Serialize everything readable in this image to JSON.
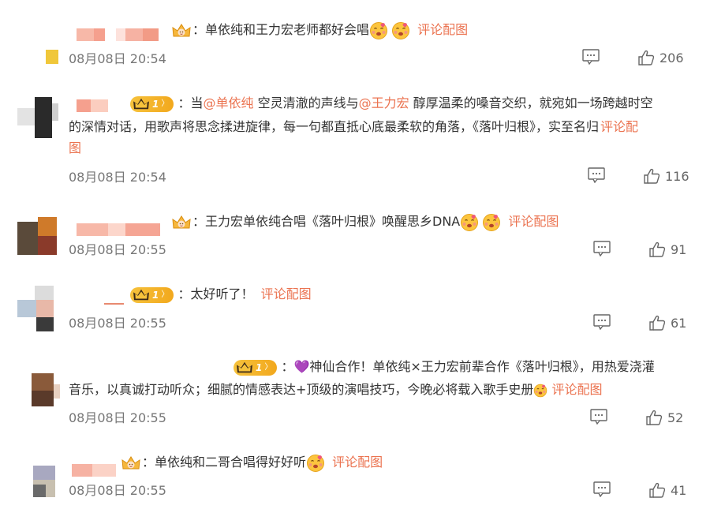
{
  "comments": [
    {
      "text_parts": [
        "：单依纯和王力宏老师都好会唱"
      ],
      "action": "评论配图",
      "time": "08月08日 20:54",
      "likes": "206"
    },
    {
      "text_line1_prefix": "：当",
      "mention1": "@单依纯",
      "text_mid1": " 空灵清澈的声线与",
      "mention2": "@王力宏",
      "text_mid2": " 醇厚温柔的嗓音交织，就宛如一场跨越时空",
      "text_line2": "的深情对话，用歌声将思念揉进旋律，每一句都直抵心底最柔软的角落，《落叶归根》，实至名归",
      "action_part1": "评论配",
      "action_part2": "图",
      "badge_num": "1",
      "time": "08月08日 20:54",
      "likes": "116"
    },
    {
      "text": "：王力宏单依纯合唱《落叶归根》唤醒思乡DNA",
      "action": "评论配图",
      "time": "08月08日 20:55",
      "likes": "91"
    },
    {
      "text": "：太好听了！",
      "action": "评论配图",
      "badge_num": "1",
      "time": "08月08日 20:55",
      "likes": "61"
    },
    {
      "text_line1": "：💜神仙合作！单依纯×王力宏前辈合作《落叶归根》，用热爱浇灌",
      "text_line2": "音乐，以真诚打动听众；细腻的情感表达+顶级的演唱技巧，今晚必将载入歌手史册",
      "action": "评论配图",
      "badge_num": "1",
      "time": "08月08日 20:55",
      "likes": "52"
    },
    {
      "text": "：单依纯和二哥合唱得好好听",
      "action": "评论配图",
      "time": "08月08日 20:55",
      "likes": "41"
    }
  ],
  "icons": {
    "reply": "comment-icon",
    "like": "thumbs-up-icon",
    "vip": "crown-badge-icon",
    "fan": "fan-badge-icon",
    "emoji": "emoji-face-icon"
  },
  "colors": {
    "link": "#eb7350",
    "text": "#333333",
    "meta": "#777777",
    "badge_gold": "#f2a81d"
  }
}
